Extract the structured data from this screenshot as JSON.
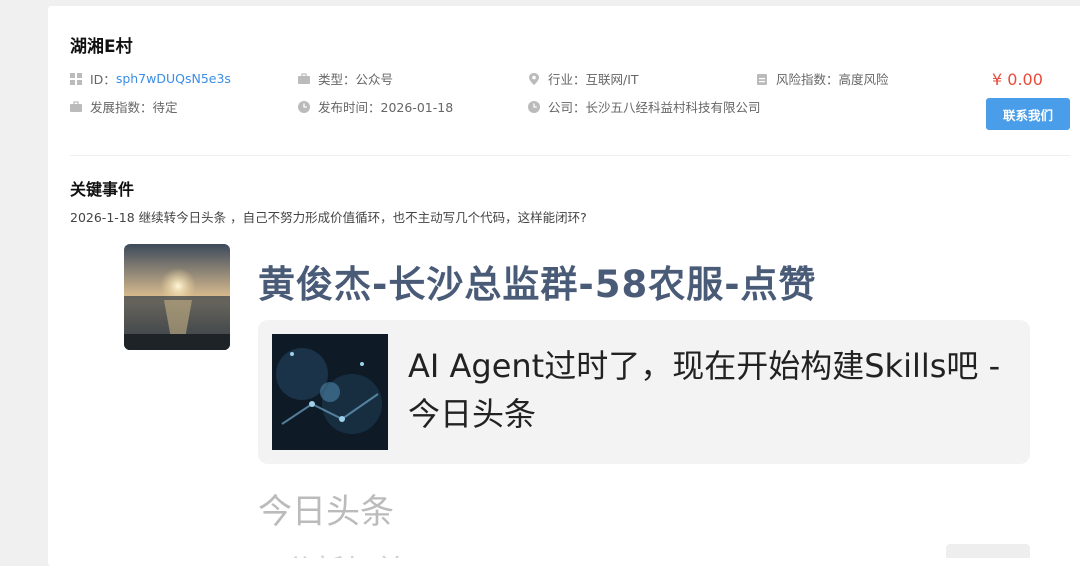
{
  "header": {
    "title": "湖湘E村",
    "id_label": "ID：",
    "id_value": "sph7wDUQsN5e3s",
    "type": "类型：公众号",
    "industry": "行业：互联网/IT",
    "risk": "风险指数：高度风险",
    "development": "发展指数：待定",
    "published": "发布时间：2026-01-18",
    "company": "公司：长沙五八经科益村科技有限公司",
    "price": "¥ 0.00",
    "contact_label": "联系我们"
  },
  "icons": {
    "id": "grid-icon",
    "type": "briefcase-icon",
    "industry": "location-pin-icon",
    "risk": "clipboard-icon",
    "development": "briefcase-icon",
    "published": "clock-icon",
    "company": "clock-icon"
  },
  "events": {
    "section_title": "关键事件",
    "text": "2026-1-18 继续转今日头条 ，自己不努力形成价值循环，也不主动写几个代码，这样能闭环?"
  },
  "screenshot": {
    "group_title": "黄俊杰-长沙总监群-58农服-点赞",
    "share_title": "AI Agent过时了，现在开始构建Skills吧 - 今日头条",
    "source": "今日头条",
    "partial_line": "• 分析加单"
  },
  "colors": {
    "accent": "#4a9de8",
    "link": "#3a8ee6",
    "price": "#e84b3c",
    "group_title": "#4a5b78"
  }
}
